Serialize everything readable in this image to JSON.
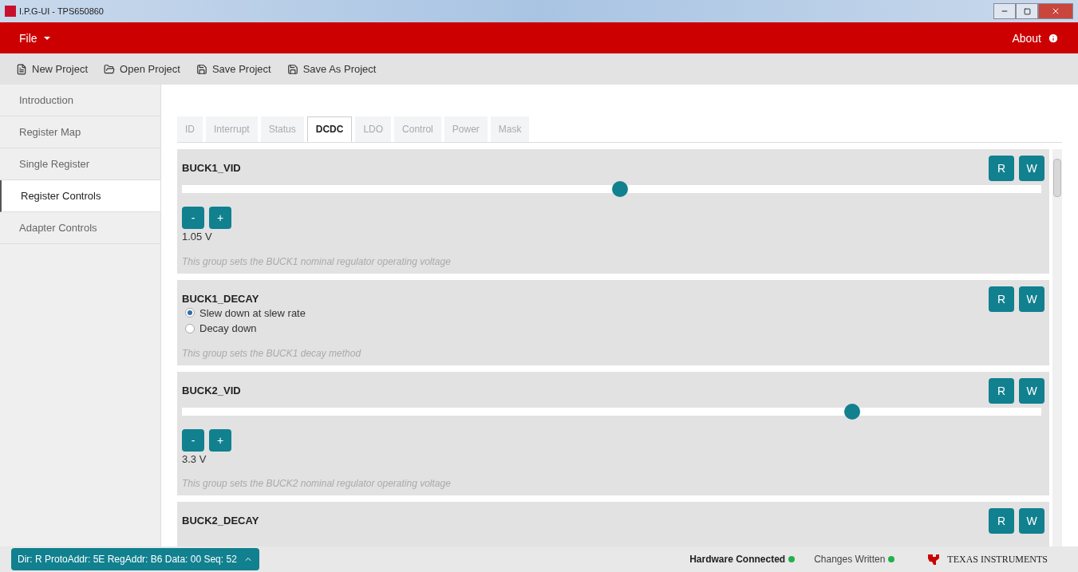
{
  "window": {
    "title": "I.P.G-UI - TPS650860"
  },
  "menu_bar": {
    "file": "File",
    "about": "About"
  },
  "toolbar": [
    {
      "label": "New Project",
      "kind": "new"
    },
    {
      "label": "Open Project",
      "kind": "open"
    },
    {
      "label": "Save Project",
      "kind": "save"
    },
    {
      "label": "Save As Project",
      "kind": "save"
    }
  ],
  "sidebar": {
    "items": [
      {
        "label": "Introduction",
        "selected": false
      },
      {
        "label": "Register Map",
        "selected": false
      },
      {
        "label": "Single Register",
        "selected": false
      },
      {
        "label": "Register Controls",
        "selected": true
      },
      {
        "label": "Adapter Controls",
        "selected": false
      }
    ]
  },
  "tabs": [
    {
      "label": "ID",
      "selected": false
    },
    {
      "label": "Interrupt",
      "selected": false
    },
    {
      "label": "Status",
      "selected": false
    },
    {
      "label": "DCDC",
      "selected": true
    },
    {
      "label": "LDO",
      "selected": false
    },
    {
      "label": "Control",
      "selected": false
    },
    {
      "label": "Power",
      "selected": false
    },
    {
      "label": "Mask",
      "selected": false
    }
  ],
  "groups": [
    {
      "kind": "slider",
      "title": "BUCK1_VID",
      "read": "R",
      "write": "W",
      "level": 0.51,
      "minus": "-",
      "plus": "+",
      "value": "1.05 V",
      "description": "This group sets the BUCK1 nominal regulator operating voltage"
    },
    {
      "kind": "radio",
      "title": "BUCK1_DECAY",
      "read": "R",
      "write": "W",
      "options": [
        {
          "label": "Slew down at slew rate",
          "selected": true
        },
        {
          "label": "Decay down",
          "selected": false
        }
      ],
      "description": "This group sets the BUCK1 decay method"
    },
    {
      "kind": "slider",
      "title": "BUCK2_VID",
      "read": "R",
      "write": "W",
      "level": 0.78,
      "minus": "-",
      "plus": "+",
      "value": "3.3 V",
      "description": "This group sets the BUCK2 nominal regulator operating voltage"
    },
    {
      "kind": "partial",
      "title": "BUCK2_DECAY",
      "read": "R",
      "write": "W"
    }
  ],
  "status_bar": {
    "transaction": "Dir: R ProtoAddr: 5E RegAddr: B6 Data: 00 Seq: 52",
    "indicators": [
      {
        "label": "Hardware Connected",
        "color": "#22b14c",
        "bold": true
      },
      {
        "label": "Changes Written",
        "color": "#22b14c",
        "bold": false
      }
    ],
    "brand": "TEXAS INSTRUMENTS"
  }
}
